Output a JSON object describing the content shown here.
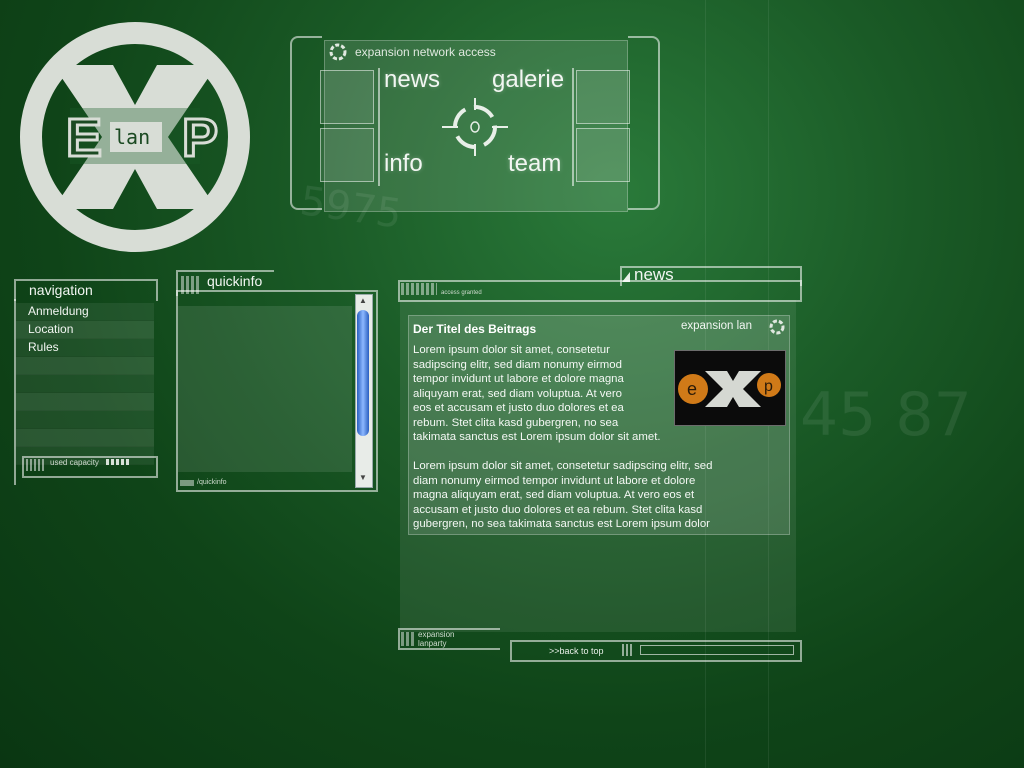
{
  "logo": {
    "text": "lan"
  },
  "hub": {
    "title": "expansion network access",
    "links": {
      "news": "news",
      "galerie": "galerie",
      "info": "info",
      "team": "team"
    }
  },
  "navigation": {
    "title": "navigation",
    "items": [
      "Anmeldung",
      "Location",
      "Rules"
    ],
    "footer": "used capacity"
  },
  "quickinfo": {
    "title": "quickinfo",
    "footer": "/quickinfo"
  },
  "news": {
    "title": "news",
    "status": "access granted",
    "brand": "expansion lan",
    "article_title": "Der Titel des Beitrags",
    "paragraph1_lines": [
      "Lorem ipsum dolor sit amet, consetetur",
      "sadipscing elitr, sed diam nonumy eirmod",
      "tempor invidunt ut labore et dolore magna",
      "aliquyam erat, sed diam voluptua. At vero",
      "eos et accusam et justo duo dolores et ea",
      "rebum. Stet clita kasd gubergren, no sea",
      "takimata sanctus est Lorem ipsum dolor sit amet."
    ],
    "paragraph2_lines": [
      "Lorem ipsum dolor sit amet, consetetur sadipscing elitr, sed",
      "diam nonumy eirmod tempor invidunt ut labore et dolore",
      "magna aliquyam erat, sed diam voluptua. At vero eos et",
      "accusam et justo duo dolores et ea rebum. Stet clita kasd",
      "gubergren, no sea takimata sanctus est Lorem ipsum dolor"
    ],
    "footer_label_1": "expansion",
    "footer_label_2": "lanparty",
    "back_to_top": ">>back to top"
  },
  "colors": {
    "background": "#1a5a26",
    "accent": "#e8f0e8"
  },
  "icons": [
    "ring-icon",
    "crosshair-icon",
    "grid-icon",
    "scroll-up-icon",
    "scroll-down-icon"
  ]
}
